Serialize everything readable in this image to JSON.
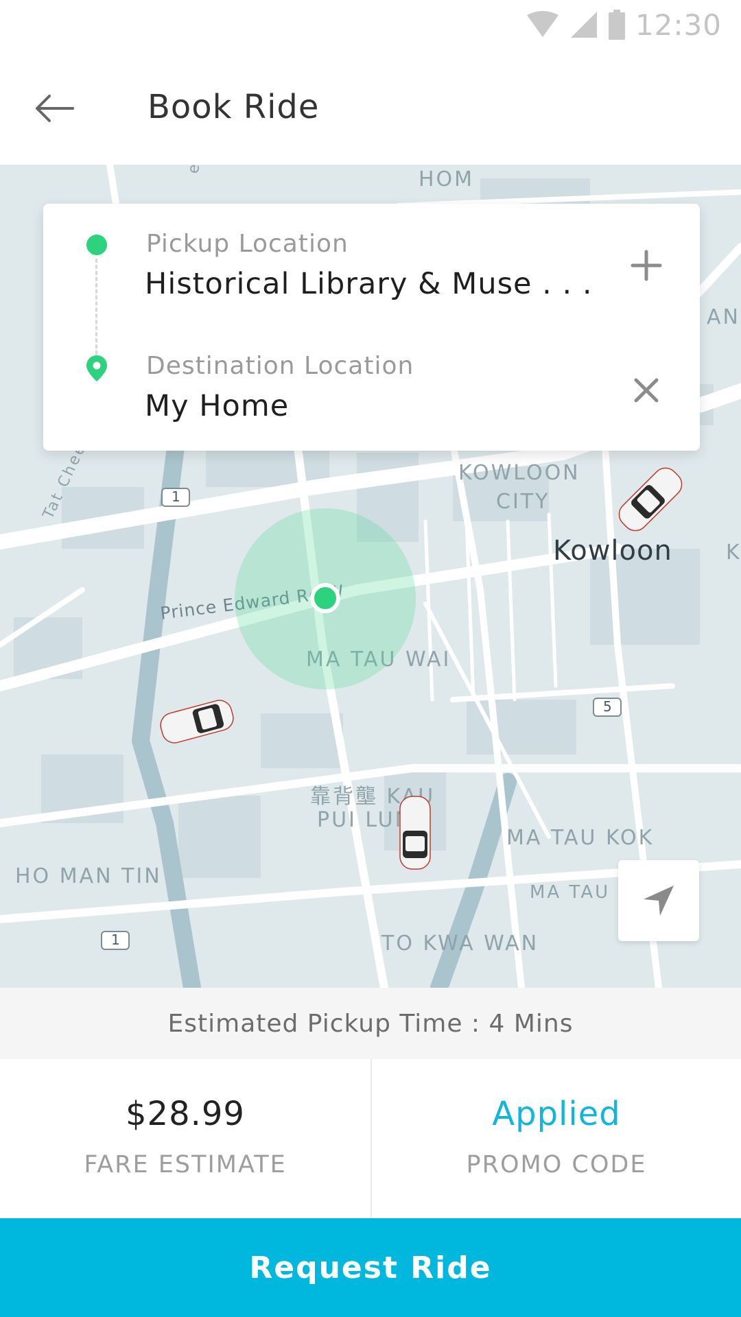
{
  "status_bar": {
    "time": "12:30",
    "icons": [
      "wifi-icon",
      "signal-icon",
      "battery-icon"
    ]
  },
  "header": {
    "title": "Book Ride",
    "back_icon": "arrow-left-icon"
  },
  "locations": {
    "pickup": {
      "label": "Pickup Location",
      "value": "Historical Library & Muse . . .",
      "action_icon": "plus-icon"
    },
    "destination": {
      "label": "Destination Location",
      "value": "My Home",
      "action_icon": "close-icon"
    }
  },
  "map": {
    "labels": {
      "hom": "HOM",
      "kowloon_city_1": "KOWLOON",
      "kowloon_city_2": "CITY",
      "kowloon": "Kowloon",
      "k_edge": "K",
      "an_edge": "AN",
      "prince_edward": "Prince Edward Rd W",
      "ma_tau_wai": "MA TAU WAI",
      "kau_pui_lung_1": "靠背壟 KAU",
      "kau_pui_lung_2": "PUI LUNG",
      "ma_tau_kok": "MA TAU KOK",
      "ma_tau": "MA TAU",
      "ho_man_tin": "HO MAN TIN",
      "to_kwa_wan": "TO KWA WAN",
      "tat_chee": "Tat Chee",
      "waterloo": "erloo",
      "route_1a": "1",
      "route_1b": "1",
      "route_5": "5"
    },
    "locate_icon": "navigation-arrow-icon"
  },
  "eta": {
    "text": "Estimated Pickup Time : 4 Mins"
  },
  "fare": {
    "value": "$28.99",
    "caption": "FARE ESTIMATE"
  },
  "promo": {
    "value": "Applied",
    "caption": "PROMO CODE"
  },
  "request": {
    "label": "Request Ride"
  },
  "colors": {
    "accent": "#00b8de",
    "promo_text": "#12b6dc",
    "pickup_green": "#2dd27f",
    "map_bg": "#dfe9ec"
  }
}
